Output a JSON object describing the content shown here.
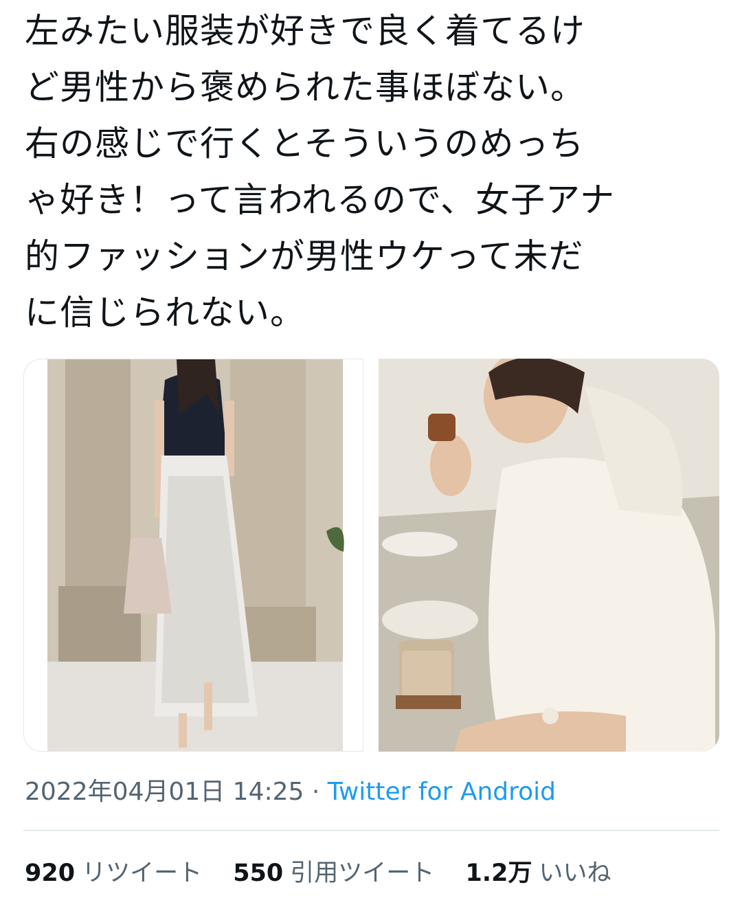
{
  "tweet": {
    "text": "左みたい服装が好きで良く着てるけ\nど男性から褒められた事ほぼない。\n右の感じで行くとそういうのめっち\nゃ好き！って言われるので、女子アナ\n的ファッションが男性ウケって未だ\nに信じられない。",
    "timestamp": "2022年04月01日 14:25",
    "separator": " · ",
    "source": "Twitter for Android"
  },
  "media": {
    "left_icon": "photo-woman-lace-skirt",
    "right_icon": "photo-woman-hoodie-eating"
  },
  "stats": [
    {
      "value": "920",
      "label": "リツイート"
    },
    {
      "value": "550",
      "label": "引用ツイート"
    },
    {
      "value": "1.2万",
      "label": "いいね"
    }
  ],
  "colors": {
    "text": "#0f1419",
    "muted": "#536471",
    "link": "#1d9bf0",
    "divider": "#cfd9de"
  }
}
